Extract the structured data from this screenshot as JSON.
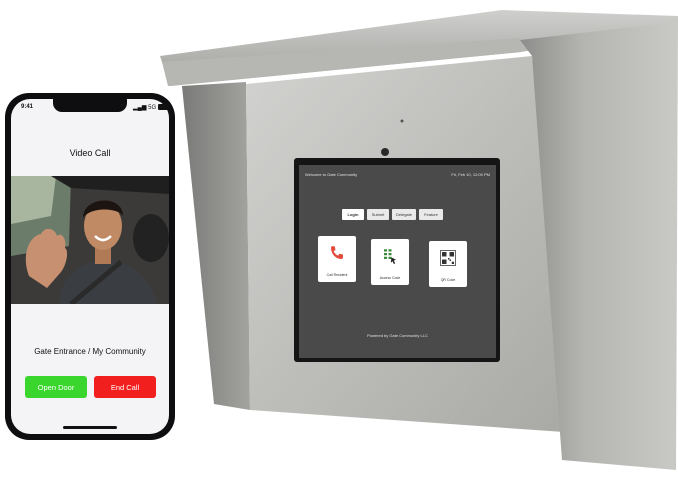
{
  "phone": {
    "status": {
      "time": "9:41",
      "signal": "5G"
    },
    "call_title": "Video Call",
    "gate_label": "Gate Entrance / My Community",
    "buttons": {
      "open_door": "Open Door",
      "end_call": "End Call"
    },
    "colors": {
      "open_door": "#3ad62e",
      "end_call": "#f21f1f"
    }
  },
  "kiosk": {
    "header_left": "Welcome to Gate Community",
    "header_right": "Fri, Feb 10, 12:00 PM",
    "tabs": [
      "Login",
      "Submit",
      "Delegate",
      "Feature"
    ],
    "active_tab": "Login",
    "cards": [
      {
        "label": "Call Resident",
        "icon": "phone-icon"
      },
      {
        "label": "Access Code",
        "icon": "keypad-icon"
      },
      {
        "label": "QR Code",
        "icon": "qr-code-icon"
      }
    ],
    "footer": "Powered by Gate Community LLC"
  }
}
